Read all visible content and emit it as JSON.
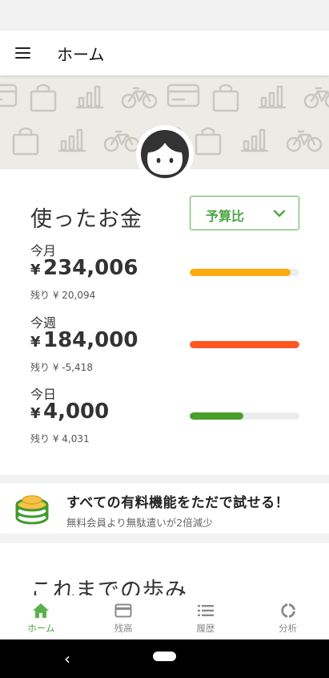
{
  "colors": {
    "accent": "#59b14e",
    "month_bar": "#fbab12",
    "week_bar": "#ff5722",
    "day_bar": "#4a9f2c",
    "track": "#ededed"
  },
  "appbar": {
    "title": "ホーム",
    "menu_icon": "hamburger-menu-icon"
  },
  "banner": {
    "icons": [
      "wallet-icon",
      "shopping-bag-icon",
      "bar-chart-icon",
      "bicycle-icon"
    ]
  },
  "avatar": {
    "icon": "avatar-face-icon"
  },
  "spending": {
    "title": "使ったお金",
    "budget_select": {
      "label": "予算比",
      "icon": "chevron-down-icon"
    },
    "periods": [
      {
        "name": "今月",
        "currency": "¥",
        "amount": "234,006",
        "remaining": "残り ¥ 20,094",
        "progress": 0.92
      },
      {
        "name": "今週",
        "currency": "¥",
        "amount": "184,000",
        "remaining": "残り ¥ -5,418",
        "progress": 1.0
      },
      {
        "name": "今日",
        "currency": "¥",
        "amount": "4,000",
        "remaining": "残り ¥ 4,031",
        "progress": 0.49
      }
    ]
  },
  "promo": {
    "title": "すべての有料機能をただで試せる！",
    "subtitle": "無料会員より無駄遣いが2倍減少",
    "icon": "coin-stack-icon"
  },
  "history": {
    "title": "これまでの歩み"
  },
  "bottom_nav": {
    "items": [
      {
        "label": "ホーム",
        "icon": "home-icon",
        "active": true
      },
      {
        "label": "残高",
        "icon": "credit-card-icon",
        "active": false
      },
      {
        "label": "履歴",
        "icon": "list-icon",
        "active": false
      },
      {
        "label": "分析",
        "icon": "donut-chart-icon",
        "active": false
      }
    ]
  },
  "system_nav": {
    "back_icon": "back-chevron-icon",
    "home_icon": "home-pill-icon"
  }
}
